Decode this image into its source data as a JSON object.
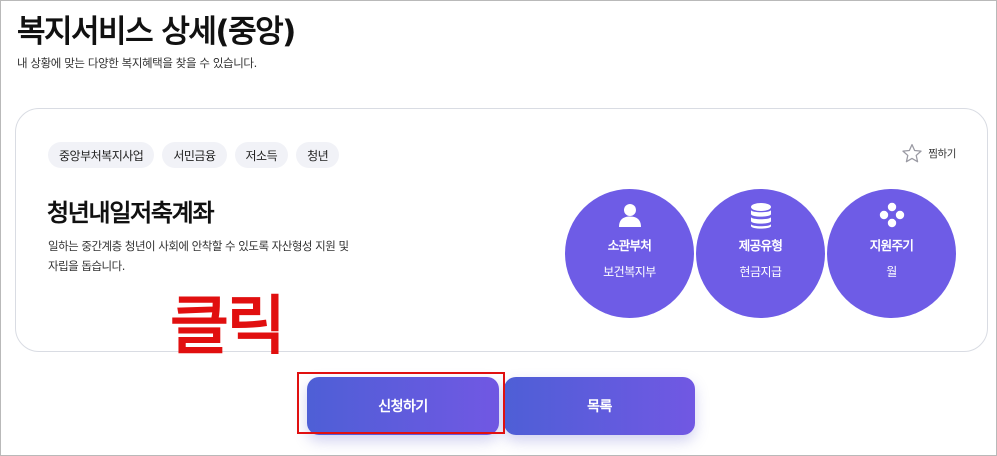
{
  "page": {
    "title": "복지서비스 상세(중앙)",
    "subtitle": "내 상황에 맞는 다양한 복지혜택을 찾을 수 있습니다."
  },
  "service": {
    "tags": [
      "중앙부처복지사업",
      "서민금융",
      "저소득",
      "청년"
    ],
    "favorite_label": "찜하기",
    "title": "청년내일저축계좌",
    "description": "일하는 중간계층 청년이 사회에 안착할 수 있도록 자산형성 지원 및 자립을 돕습니다.",
    "info": [
      {
        "label": "소관부처",
        "value": "보건복지부",
        "icon": "person-icon"
      },
      {
        "label": "제공유형",
        "value": "현금지급",
        "icon": "coin-stack-icon"
      },
      {
        "label": "지원주기",
        "value": "월",
        "icon": "diamond-dots-icon"
      }
    ]
  },
  "annotation": {
    "text": "클릭",
    "color": "#e10f0f"
  },
  "actions": {
    "apply_label": "신청하기",
    "list_label": "목록"
  },
  "colors": {
    "accent": "#6e5ce6",
    "button_gradient_start": "#4e5fd6",
    "button_gradient_end": "#7158e3",
    "highlight": "#e01010"
  }
}
